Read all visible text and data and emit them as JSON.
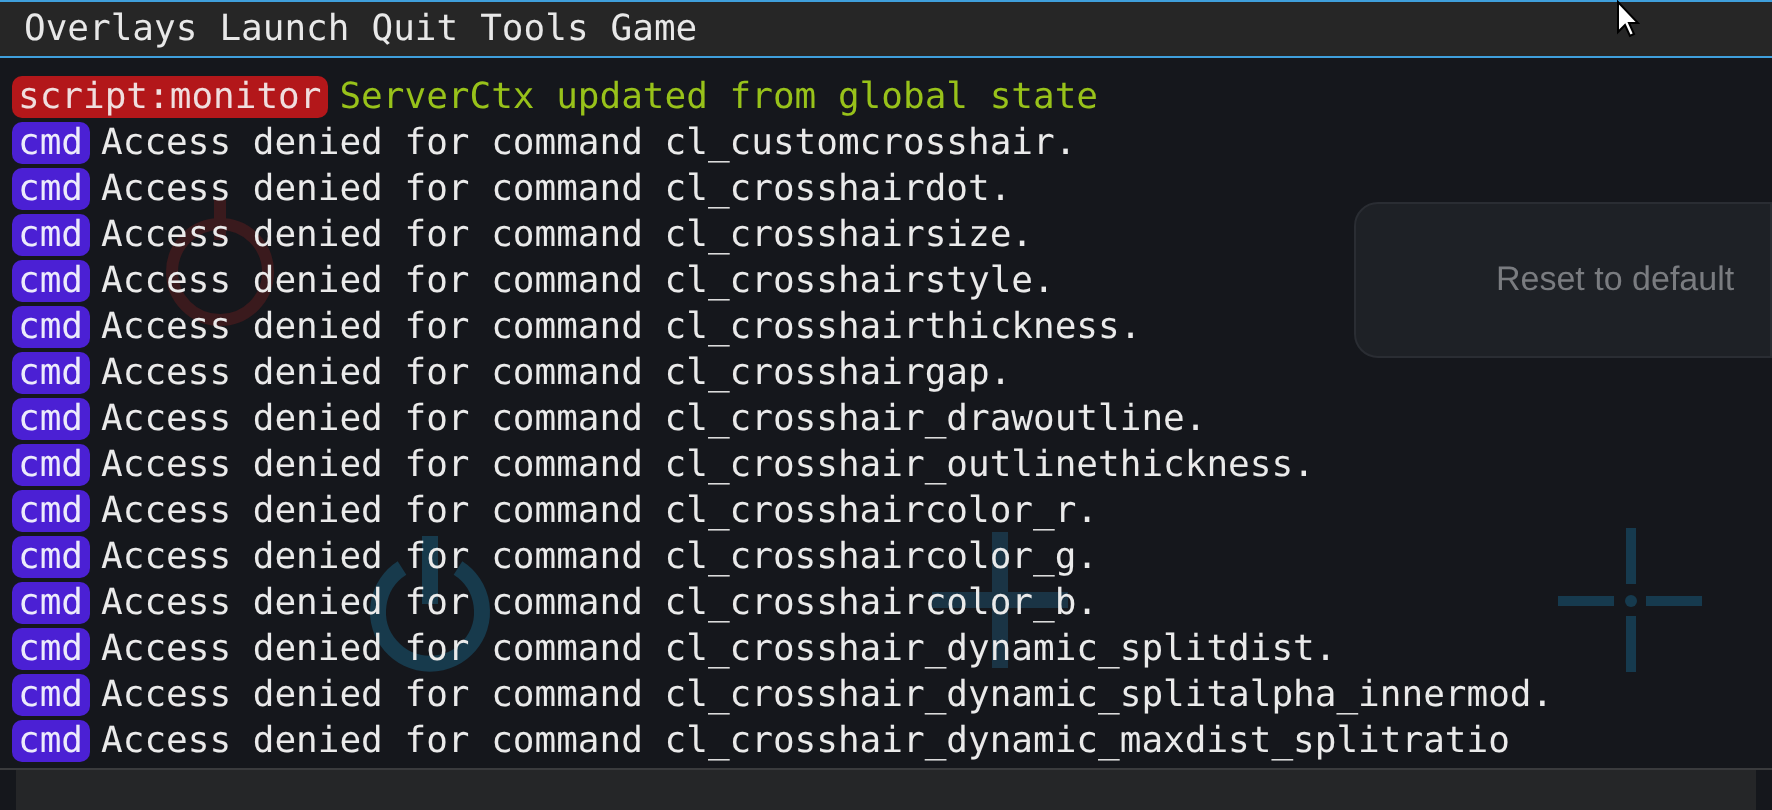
{
  "menu_bar": {
    "items": [
      "Overlays",
      "Launch",
      "Quit",
      "Tools",
      "Game"
    ]
  },
  "background_app": {
    "reset_button": "Reset to default",
    "cards": [
      {
        "kind": "power"
      },
      {
        "kind": "dot"
      },
      {
        "kind": "size"
      }
    ]
  },
  "console": {
    "entries": [
      {
        "kind": "script",
        "tag": "script:monitor",
        "message": "ServerCtx updated from global state"
      },
      {
        "kind": "cmd",
        "tag": "cmd",
        "message": "Access denied for command cl_customcrosshair."
      },
      {
        "kind": "cmd",
        "tag": "cmd",
        "message": "Access denied for command cl_crosshairdot."
      },
      {
        "kind": "cmd",
        "tag": "cmd",
        "message": "Access denied for command cl_crosshairsize."
      },
      {
        "kind": "cmd",
        "tag": "cmd",
        "message": "Access denied for command cl_crosshairstyle."
      },
      {
        "kind": "cmd",
        "tag": "cmd",
        "message": "Access denied for command cl_crosshairthickness."
      },
      {
        "kind": "cmd",
        "tag": "cmd",
        "message": "Access denied for command cl_crosshairgap."
      },
      {
        "kind": "cmd",
        "tag": "cmd",
        "message": "Access denied for command cl_crosshair_drawoutline."
      },
      {
        "kind": "cmd",
        "tag": "cmd",
        "message": "Access denied for command cl_crosshair_outlinethickness."
      },
      {
        "kind": "cmd",
        "tag": "cmd",
        "message": "Access denied for command cl_crosshaircolor_r."
      },
      {
        "kind": "cmd",
        "tag": "cmd",
        "message": "Access denied for command cl_crosshaircolor_g."
      },
      {
        "kind": "cmd",
        "tag": "cmd",
        "message": "Access denied for command cl_crosshaircolor_b."
      },
      {
        "kind": "cmd",
        "tag": "cmd",
        "message": "Access denied for command cl_crosshair_dynamic_splitdist."
      },
      {
        "kind": "cmd",
        "tag": "cmd",
        "message": "Access denied for command cl_crosshair_dynamic_splitalpha_innermod."
      },
      {
        "kind": "cmd",
        "tag": "cmd",
        "message": "Access denied for command cl_crosshair_dynamic_maxdist_splitratio"
      }
    ]
  }
}
